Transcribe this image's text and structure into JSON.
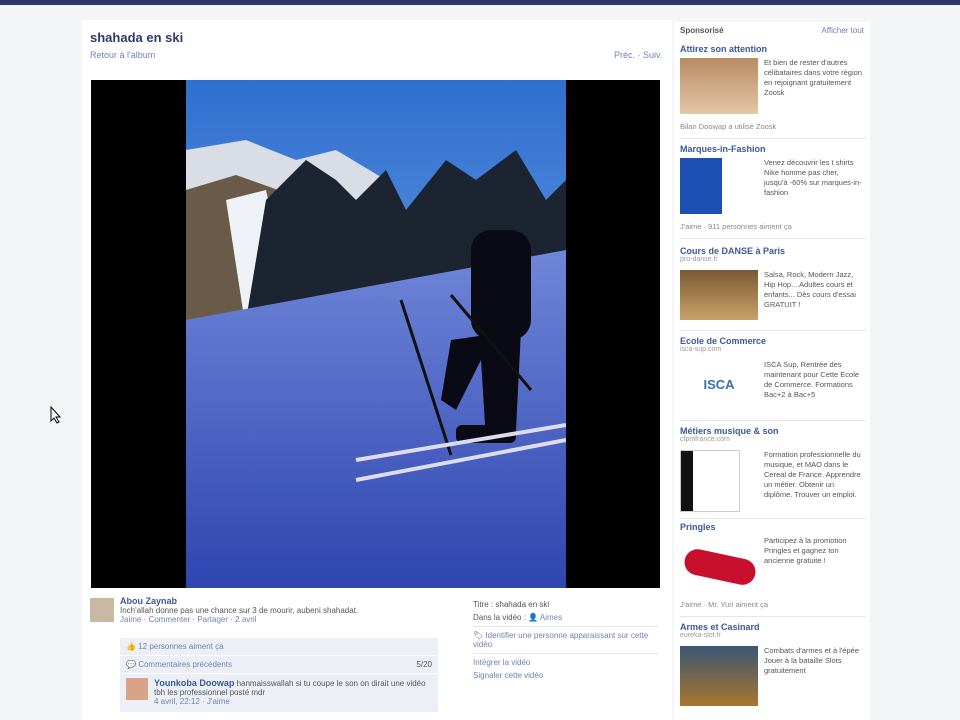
{
  "header": {
    "title": "shahada en ski",
    "back_link": "Retour à l'album",
    "nav": "Préc. · Suiv."
  },
  "video": {
    "description_icon": "video-frame"
  },
  "comments": [
    {
      "name": "Abou Zaynab",
      "text": "Inch'allah donne pas une chance sur 3 de mourir, aubeni shahadat.",
      "actions": "Jaime · Commenter · Partager · 2 avril"
    }
  ],
  "likes_row": "12 personnes aiment ça",
  "previous_comments": "Commentaires précédents",
  "previous_count": "5/20",
  "reply": {
    "name": "Younkoba Doowap",
    "text": "hanmaisswallah si tu coupe le son on dirait une vidéo tbh les professionnel posté mdr",
    "meta": "4 avril, 22:12 · J'aime"
  },
  "info": {
    "from": "Titre : shahada en ski",
    "in_video": "Dans la vidéo :",
    "tagged": "Aimes",
    "identify": "Identifier une personne apparaissant sur cette vidéo",
    "embed": "Intégrer la vidéo",
    "report": "Signaler cette vidéo"
  },
  "sidebar": {
    "heading": "Sponsorisé",
    "see_all": "Afficher tout",
    "ads": [
      {
        "title": "Attirez son attention",
        "sub": "",
        "text": "Et bien de rester d'autres célibataires dans votre région en rejoignant gratuitement Zoosk",
        "like": "Bilan Doowap a utilisé Zoosk"
      },
      {
        "title": "Marques-in-Fashion",
        "sub": "",
        "text": "Venez découvrir les t shirts Nike homme pas cher, jusqu'à -60% sur marques-in-fashion",
        "like": "J'aime · 911 personnes aiment ça"
      },
      {
        "title": "Cours de DANSE à Paris",
        "sub": "pro-danse.fr",
        "text": "Salsa, Rock, Modern Jazz, Hip Hop... Adultes cours et enfants... Dès cours d'essai GRATUIT !",
        "like": ""
      },
      {
        "title": "Ecole de Commerce",
        "sub": "isca-sup.com",
        "text": "ISCA Sup, Rentrée des maintenant pour Cette Ecole de Commerce. Formations Bac+2 à Bac+5",
        "like": ""
      },
      {
        "title": "Métiers musique & son",
        "sub": "cfpmfrance.com",
        "text": "Formation professionnelle du musique, et MAO dans le Cereal de France. Apprendre un métier. Obtenir un diplôme. Trouver un emploi.",
        "like": ""
      },
      {
        "title": "Pringles",
        "sub": "",
        "text": "Participez à la promotion Pringles et gagnez ton ancienne gratuite !",
        "like": "J'aime · Mr. Yuri aiment ça"
      },
      {
        "title": "Armes et Casinard",
        "sub": "eureka-slot.fr",
        "text": "Combats d'armes et à l'épée Jouer à la bataille Slots gratuitement",
        "like": ""
      }
    ]
  },
  "colors": {
    "brand_bar": "#2b3a67",
    "link": "#3b5998",
    "sky": "#4a8ee0",
    "snow": "#3954b8"
  }
}
